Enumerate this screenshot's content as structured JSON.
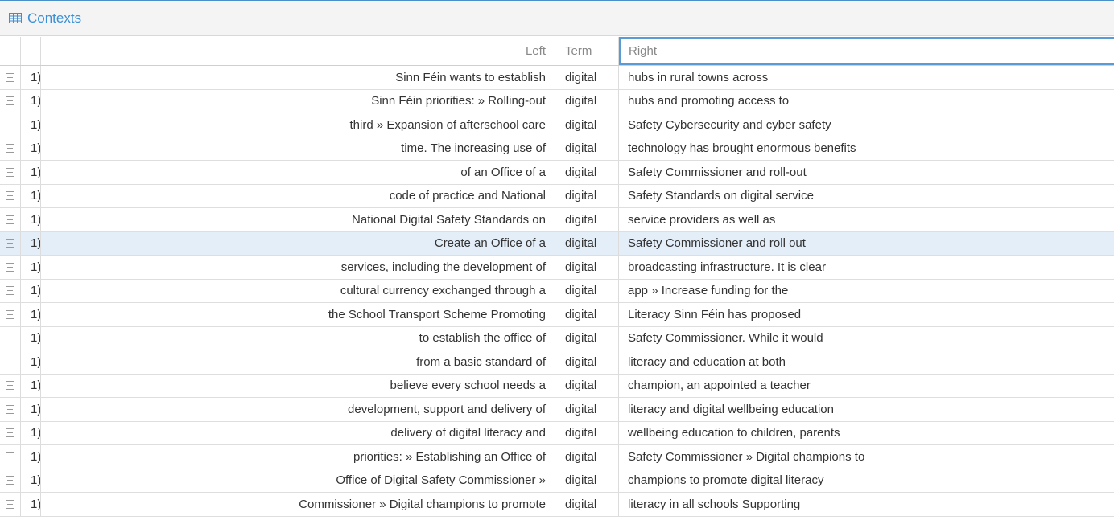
{
  "panel": {
    "title": "Contexts",
    "icon": "table-icon"
  },
  "columns": {
    "left": "Left",
    "term": "Term",
    "right": "Right"
  },
  "selected_row": 7,
  "rows": [
    {
      "num": "1)",
      "left": "Sinn Féin wants to establish",
      "term": "digital",
      "right": "hubs in rural towns across"
    },
    {
      "num": "1)",
      "left": "Sinn Féin priorities: » Rolling-out",
      "term": "digital",
      "right": "hubs and promoting access to"
    },
    {
      "num": "1)",
      "left": "third » Expansion of afterschool care",
      "term": "digital",
      "right": "Safety Cybersecurity and cyber safety"
    },
    {
      "num": "1)",
      "left": "time. The increasing use of",
      "term": "digital",
      "right": "technology has brought enormous benefits"
    },
    {
      "num": "1)",
      "left": "of an Office of a",
      "term": "digital",
      "right": "Safety Commissioner and roll-out"
    },
    {
      "num": "1)",
      "left": "code of practice and National",
      "term": "digital",
      "right": "Safety Standards on digital service"
    },
    {
      "num": "1)",
      "left": "National Digital Safety Standards on",
      "term": "digital",
      "right": "service providers as well as"
    },
    {
      "num": "1)",
      "left": "Create an Office of a",
      "term": "digital",
      "right": "Safety Commissioner and roll out"
    },
    {
      "num": "1)",
      "left": "services, including the development of",
      "term": "digital",
      "right": "broadcasting infrastructure. It is clear"
    },
    {
      "num": "1)",
      "left": "cultural currency exchanged through a",
      "term": "digital",
      "right": "app » Increase funding for the"
    },
    {
      "num": "1)",
      "left": "the School Transport Scheme Promoting",
      "term": "digital",
      "right": "Literacy Sinn Féin has proposed"
    },
    {
      "num": "1)",
      "left": "to establish the office of",
      "term": "digital",
      "right": "Safety Commissioner. While it would"
    },
    {
      "num": "1)",
      "left": "from a basic standard of",
      "term": "digital",
      "right": "literacy and education at both"
    },
    {
      "num": "1)",
      "left": "believe every school needs a",
      "term": "digital",
      "right": "champion, an appointed a teacher"
    },
    {
      "num": "1)",
      "left": "development, support and delivery of",
      "term": "digital",
      "right": "literacy and digital wellbeing education"
    },
    {
      "num": "1)",
      "left": "delivery of digital literacy and",
      "term": "digital",
      "right": "wellbeing education to children, parents"
    },
    {
      "num": "1)",
      "left": "priorities: » Establishing an Office of",
      "term": "digital",
      "right": "Safety Commissioner » Digital champions to"
    },
    {
      "num": "1)",
      "left": "Office of Digital Safety Commissioner »",
      "term": "digital",
      "right": "champions to promote digital literacy"
    },
    {
      "num": "1)",
      "left": "Commissioner » Digital champions to promote",
      "term": "digital",
      "right": "literacy in all schools Supporting"
    }
  ]
}
